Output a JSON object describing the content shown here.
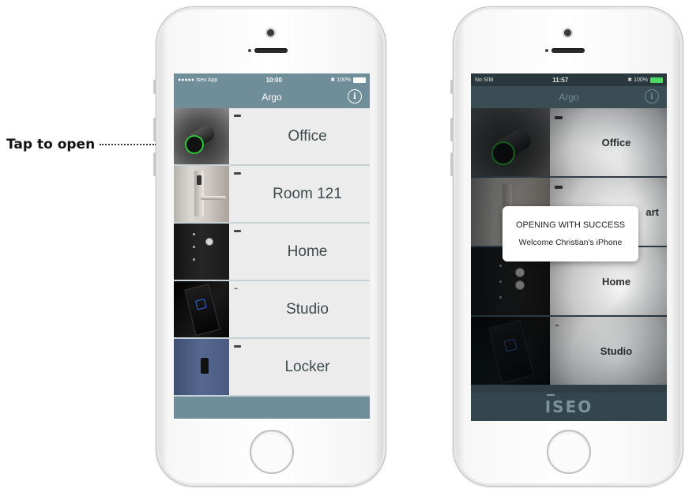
{
  "callout": {
    "text": "Tap to open"
  },
  "left_phone": {
    "status": {
      "carrier": "●●●●● Iseo App",
      "time": "10:00",
      "battery": "✱ 100%",
      "battery_level": 1.0
    },
    "nav": {
      "title": "Argo",
      "info_icon": "info-icon"
    },
    "locks": [
      {
        "name": "Office",
        "indicator": "battery",
        "thumb": "cylinder-lock"
      },
      {
        "name": "Room 121",
        "indicator": "battery",
        "thumb": "door-handle"
      },
      {
        "name": "Home",
        "indicator": "battery",
        "thumb": "dark-door"
      },
      {
        "name": "Studio",
        "indicator": "low-battery",
        "thumb": "wall-reader"
      },
      {
        "name": "Locker",
        "indicator": "battery",
        "thumb": "locker-door"
      }
    ]
  },
  "right_phone": {
    "status": {
      "carrier": "No SIM",
      "time": "11:57",
      "battery": "✱ 100%",
      "battery_level": 1.0
    },
    "nav": {
      "title": "Argo",
      "info_icon": "info-icon"
    },
    "locks": [
      {
        "name": "Office",
        "indicator": "battery",
        "thumb": "cylinder-lock"
      },
      {
        "name": "art",
        "indicator": "battery",
        "thumb": "door-handle"
      },
      {
        "name": "Home",
        "indicator": "battery",
        "thumb": "dark-door"
      },
      {
        "name": "Studio",
        "indicator": "low-battery",
        "thumb": "wall-reader"
      }
    ],
    "toast": {
      "title": "OPENING WITH SUCCESS",
      "message": "Welcome Christian's iPhone"
    },
    "footer_logo": "ISEO"
  },
  "colors": {
    "navbar_left": "#6f8e99",
    "screen_dark": "#2e3e44",
    "row_background": "#ececec",
    "success_ring": "#2ec93a",
    "reader_led": "#2e6fd6"
  }
}
